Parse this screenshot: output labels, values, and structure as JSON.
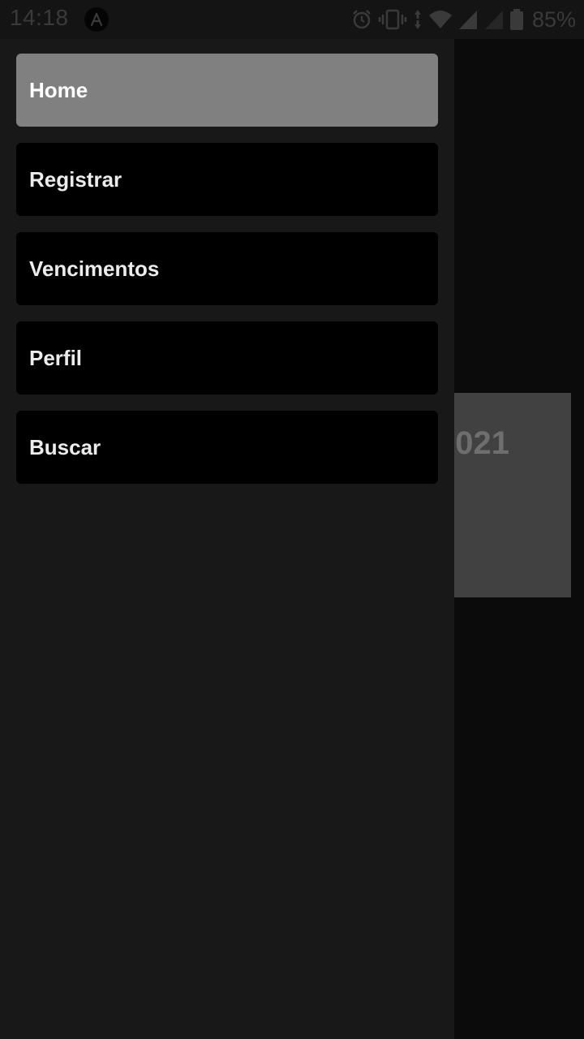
{
  "status_bar": {
    "time": "14:18",
    "battery_percent": "85%",
    "icons": [
      "app-notification-icon",
      "alarm-icon",
      "vibrate-icon",
      "data-arrows-icon",
      "wifi-icon",
      "cell-signal-icon",
      "cell-signal-empty-icon",
      "battery-icon"
    ]
  },
  "drawer": {
    "items": [
      {
        "label": "Home",
        "active": true
      },
      {
        "label": "Registrar",
        "active": false
      },
      {
        "label": "Vencimentos",
        "active": false
      },
      {
        "label": "Perfil",
        "active": false
      },
      {
        "label": "Buscar",
        "active": false
      }
    ]
  },
  "background": {
    "card_text": "021"
  },
  "colors": {
    "drawer_bg": "#181818",
    "item_bg": "#000000",
    "item_active_bg": "#808080",
    "item_text": "#ececec"
  }
}
